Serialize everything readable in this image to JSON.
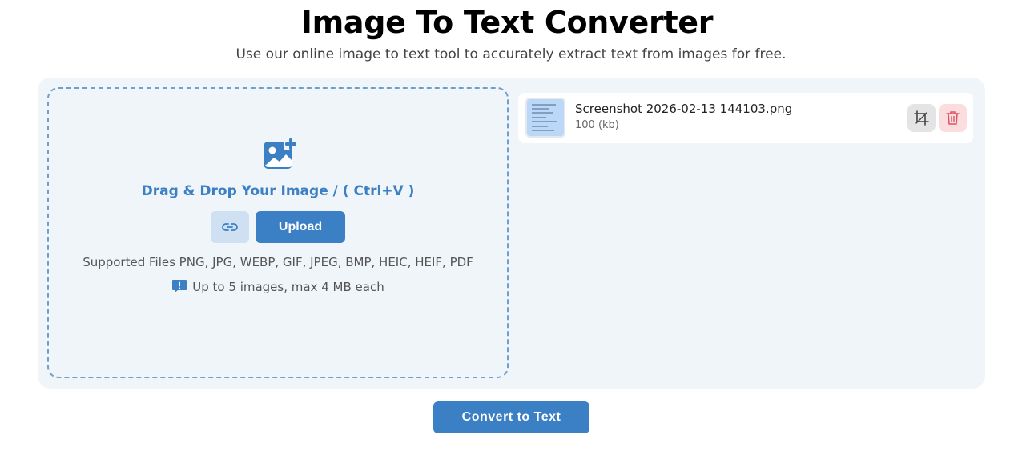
{
  "header": {
    "title": "Image To Text Converter",
    "subtitle": "Use our online image to text tool to accurately extract text from images for free."
  },
  "dropzone": {
    "icon": "add-image-icon",
    "drop_text": "Drag & Drop Your Image / ( Ctrl+V )",
    "link_icon": "link-icon",
    "upload_label": "Upload",
    "supported_text": "Supported Files PNG, JPG, WEBP, GIF, JPEG, BMP, HEIC, HEIF, PDF",
    "limit_icon": "info-message-icon",
    "limit_text": "Up to 5 images, max 4 MB each"
  },
  "files": [
    {
      "name": "Screenshot 2026-02-13 144103.png",
      "size": "100 (kb)",
      "crop_icon": "crop-icon",
      "delete_icon": "trash-icon"
    }
  ],
  "actions": {
    "convert_label": "Convert to Text"
  },
  "colors": {
    "accent": "#3b7fc4",
    "panel_bg": "#f0f5f9",
    "delete_bg": "#fbdde0",
    "delete_icon": "#e05563"
  }
}
